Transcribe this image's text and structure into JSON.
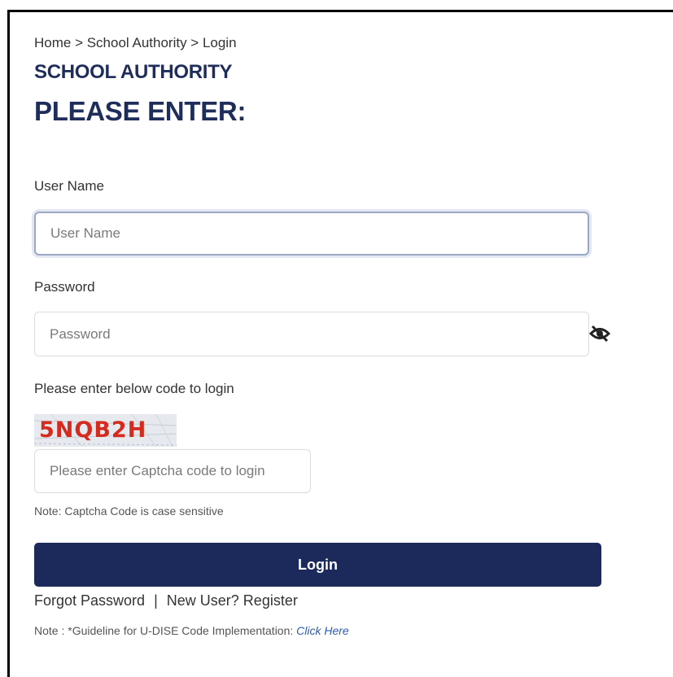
{
  "breadcrumb": "Home > School Authority > Login",
  "header": {
    "subtitle": "SCHOOL AUTHORITY",
    "title": "PLEASE ENTER:"
  },
  "username": {
    "label": "User Name",
    "placeholder": "User Name",
    "value": ""
  },
  "password": {
    "label": "Password",
    "placeholder": "Password",
    "value": "",
    "toggle_icon": "eye-slash-icon"
  },
  "captcha": {
    "prompt": "Please enter below code to login",
    "code": "5NQB2H",
    "placeholder": "Please enter Captcha code to login",
    "note": "Note: Captcha Code is case sensitive"
  },
  "login_button": "Login",
  "links": {
    "forgot": "Forgot Password",
    "separator": "|",
    "register": "New User? Register"
  },
  "footer_note": {
    "text": "Note : *Guideline for U-DISE Code Implementation: ",
    "link": "Click Here"
  },
  "colors": {
    "primary": "#1b2a5a",
    "heading": "#1f2d5a",
    "captcha_text": "#d42b1e",
    "link": "#2a5db0"
  }
}
